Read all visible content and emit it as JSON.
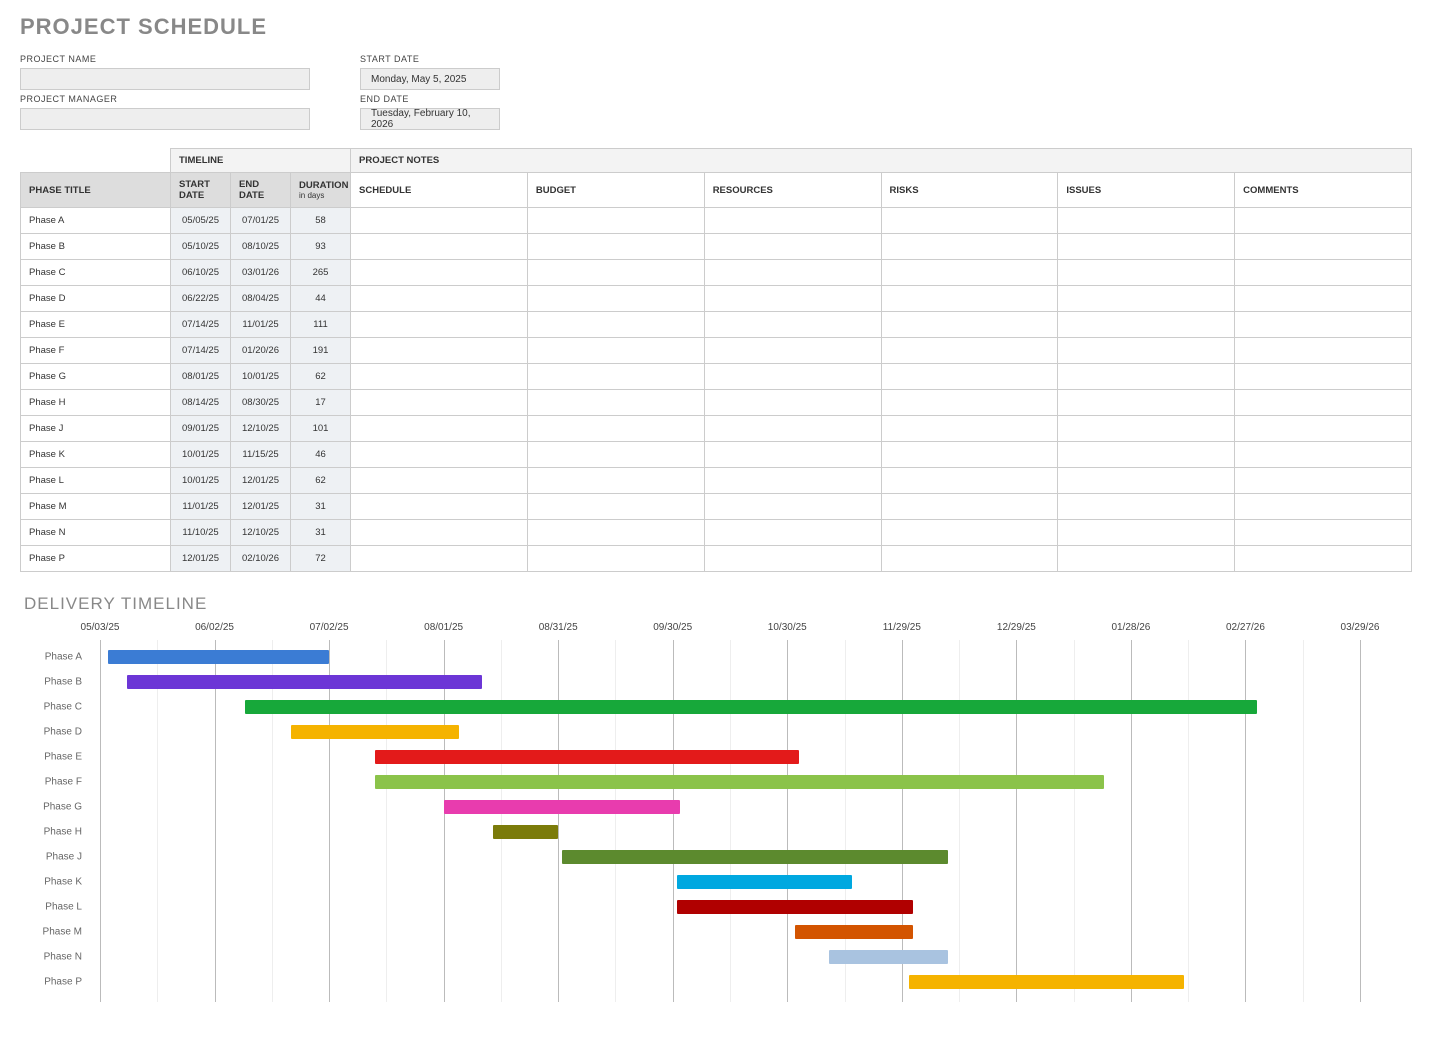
{
  "title": "PROJECT SCHEDULE",
  "meta": {
    "project_name_label": "PROJECT NAME",
    "project_name_value": "",
    "project_manager_label": "PROJECT MANAGER",
    "project_manager_value": "",
    "start_date_label": "START DATE",
    "start_date_value": "Monday, May 5, 2025",
    "end_date_label": "END DATE",
    "end_date_value": "Tuesday, February 10, 2026"
  },
  "table": {
    "timeline_header": "TIMELINE",
    "notes_header": "PROJECT NOTES",
    "phase_title_header": "PHASE TITLE",
    "start_date_header": "START DATE",
    "end_date_header": "END DATE",
    "duration_header": "DURATION",
    "duration_sub": "in days",
    "notes_columns": [
      "SCHEDULE",
      "BUDGET",
      "RESOURCES",
      "RISKS",
      "ISSUES",
      "COMMENTS"
    ],
    "rows": [
      {
        "phase": "Phase A",
        "start": "05/05/25",
        "end": "07/01/25",
        "dur": "58"
      },
      {
        "phase": "Phase B",
        "start": "05/10/25",
        "end": "08/10/25",
        "dur": "93"
      },
      {
        "phase": "Phase C",
        "start": "06/10/25",
        "end": "03/01/26",
        "dur": "265"
      },
      {
        "phase": "Phase D",
        "start": "06/22/25",
        "end": "08/04/25",
        "dur": "44"
      },
      {
        "phase": "Phase E",
        "start": "07/14/25",
        "end": "11/01/25",
        "dur": "111"
      },
      {
        "phase": "Phase F",
        "start": "07/14/25",
        "end": "01/20/26",
        "dur": "191"
      },
      {
        "phase": "Phase G",
        "start": "08/01/25",
        "end": "10/01/25",
        "dur": "62"
      },
      {
        "phase": "Phase H",
        "start": "08/14/25",
        "end": "08/30/25",
        "dur": "17"
      },
      {
        "phase": "Phase J",
        "start": "09/01/25",
        "end": "12/10/25",
        "dur": "101"
      },
      {
        "phase": "Phase K",
        "start": "10/01/25",
        "end": "11/15/25",
        "dur": "46"
      },
      {
        "phase": "Phase L",
        "start": "10/01/25",
        "end": "12/01/25",
        "dur": "62"
      },
      {
        "phase": "Phase M",
        "start": "11/01/25",
        "end": "12/01/25",
        "dur": "31"
      },
      {
        "phase": "Phase N",
        "start": "11/10/25",
        "end": "12/10/25",
        "dur": "31"
      },
      {
        "phase": "Phase P",
        "start": "12/01/25",
        "end": "02/10/26",
        "dur": "72"
      }
    ]
  },
  "timeline_title": "DELIVERY TIMELINE",
  "chart_data": {
    "type": "gantt",
    "title": "DELIVERY TIMELINE",
    "x_ticks": [
      "05/03/25",
      "06/02/25",
      "07/02/25",
      "08/01/25",
      "08/31/25",
      "09/30/25",
      "10/30/25",
      "11/29/25",
      "12/29/25",
      "01/28/26",
      "02/27/26",
      "03/29/26"
    ],
    "x_range_day0": 0,
    "x_range_day1": 330,
    "series": [
      {
        "name": "Phase A",
        "start_day": 2,
        "duration": 58,
        "color": "#3B7CD4"
      },
      {
        "name": "Phase B",
        "start_day": 7,
        "duration": 93,
        "color": "#6C36D6"
      },
      {
        "name": "Phase C",
        "start_day": 38,
        "duration": 265,
        "color": "#17A83A"
      },
      {
        "name": "Phase D",
        "start_day": 50,
        "duration": 44,
        "color": "#F5B300"
      },
      {
        "name": "Phase E",
        "start_day": 72,
        "duration": 111,
        "color": "#E31A1A"
      },
      {
        "name": "Phase F",
        "start_day": 72,
        "duration": 191,
        "color": "#8BC34A"
      },
      {
        "name": "Phase G",
        "start_day": 90,
        "duration": 62,
        "color": "#E83CAE"
      },
      {
        "name": "Phase H",
        "start_day": 103,
        "duration": 17,
        "color": "#7B7B0A"
      },
      {
        "name": "Phase J",
        "start_day": 121,
        "duration": 101,
        "color": "#5C8A2E"
      },
      {
        "name": "Phase K",
        "start_day": 151,
        "duration": 46,
        "color": "#00A8E0"
      },
      {
        "name": "Phase L",
        "start_day": 151,
        "duration": 62,
        "color": "#B00000"
      },
      {
        "name": "Phase M",
        "start_day": 182,
        "duration": 31,
        "color": "#D35400"
      },
      {
        "name": "Phase N",
        "start_day": 191,
        "duration": 31,
        "color": "#A9C3E0"
      },
      {
        "name": "Phase P",
        "start_day": 212,
        "duration": 72,
        "color": "#F5B300"
      }
    ]
  }
}
